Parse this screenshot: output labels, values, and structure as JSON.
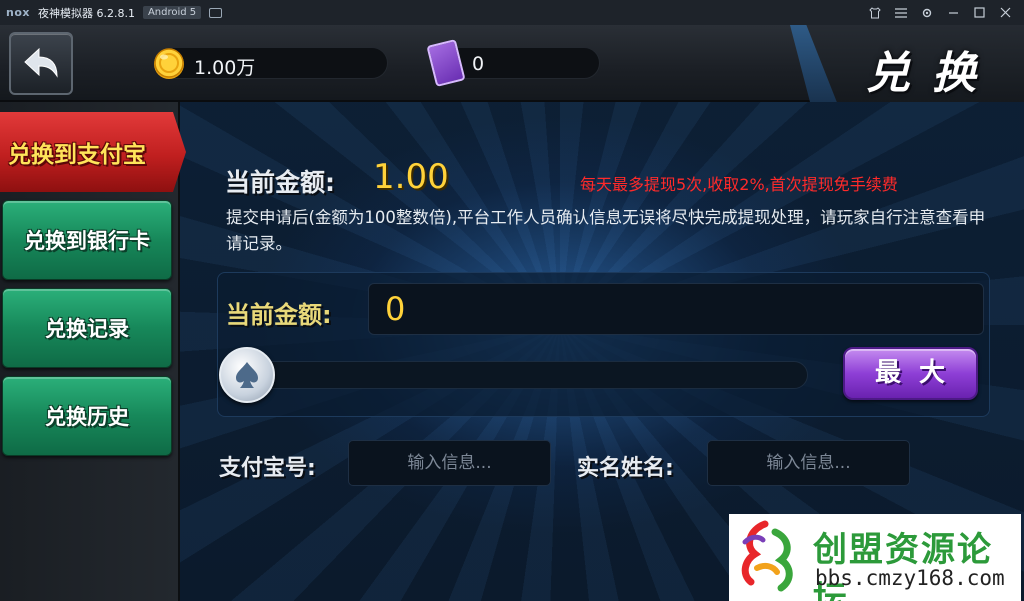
{
  "emulator": {
    "logo": "nox",
    "title": "夜神模拟器 6.2.8.1",
    "android_badge": "Android 5"
  },
  "header": {
    "coins": "1.00万",
    "cards": "0",
    "title": "兑换"
  },
  "sidenav": {
    "items": [
      {
        "label": "兑换到支付宝",
        "active": true
      },
      {
        "label": "兑换到银行卡",
        "active": false
      },
      {
        "label": "兑换记录",
        "active": false
      },
      {
        "label": "兑换历史",
        "active": false
      }
    ]
  },
  "main": {
    "current_amount_label": "当前金额:",
    "current_amount_value": "1.00",
    "notice": "每天最多提现5次,收取2%,首次提现免手续费",
    "description": "提交申请后(金额为100整数倍),平台工作人员确认信息无误将尽快完成提现处理，请玩家自行注意查看申请记录。",
    "withdraw_amount_label": "当前金额:",
    "withdraw_amount_value": "0",
    "slider_value": 0,
    "max_button": "最大",
    "alipay_label": "支付宝号:",
    "alipay_placeholder": "输入信息...",
    "realname_label": "实名姓名:",
    "realname_placeholder": "输入信息..."
  },
  "watermark": {
    "name": "创盟资源论坛",
    "url": "bbs.cmzy168.com"
  },
  "colors": {
    "accent_gold": "#ffd23a",
    "notice_red": "#ff2a2a",
    "nav_green": "#17885a",
    "nav_active_red": "#c01f1f",
    "max_purple": "#8e3fd6"
  }
}
